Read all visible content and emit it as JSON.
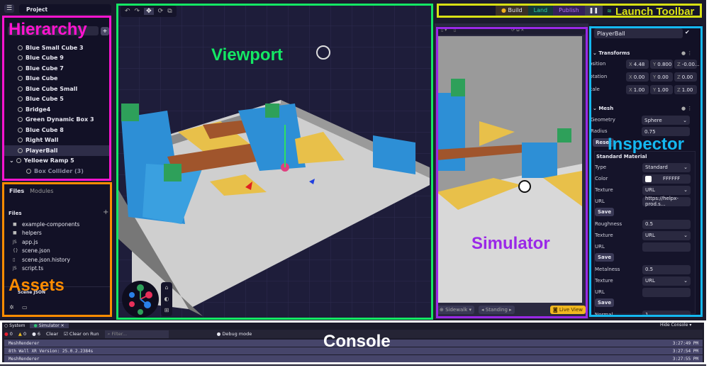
{
  "annotations": {
    "hierarchy": "Hierarchy",
    "viewport": "Viewport",
    "launch_toolbar": "Launch Toolbar",
    "inspector": "Inspector",
    "simulator": "Simulator",
    "assets": "Assets",
    "console": "Console"
  },
  "colors": {
    "hierarchy": "#ff14d0",
    "viewport": "#14e864",
    "launch_toolbar": "#d8e014",
    "inspector": "#14b8f0",
    "simulator": "#9a28e8",
    "assets": "#ff8c00",
    "console": "#ffffff"
  },
  "header": {
    "project_tab": "Project"
  },
  "hierarchy": {
    "items": [
      {
        "label": "Blue Small Cube 3"
      },
      {
        "label": "Blue Cube 9"
      },
      {
        "label": "Blue Cube 7"
      },
      {
        "label": "Blue Cube"
      },
      {
        "label": "Blue Cube Small"
      },
      {
        "label": "Blue Cube 5"
      },
      {
        "label": "Bridge4"
      },
      {
        "label": "Green Dynamic Box 3"
      },
      {
        "label": "Blue Cube 8"
      },
      {
        "label": "Right Wall"
      },
      {
        "label": "PlayerBall",
        "selected": true
      },
      {
        "label": "Yelloew Ramp 5",
        "expanded": true
      },
      {
        "label": "Box Collider (3)",
        "child": true
      }
    ]
  },
  "assets": {
    "tabs": [
      "Files",
      "Modules"
    ],
    "section": "Files",
    "files": [
      {
        "icon": "folder-icon",
        "glyph": "■",
        "name": "example-components"
      },
      {
        "icon": "folder-icon",
        "glyph": "■",
        "name": "helpers"
      },
      {
        "icon": "js-icon",
        "glyph": "JS",
        "name": "app.js"
      },
      {
        "icon": "json-icon",
        "glyph": "{}",
        "name": "scene.json"
      },
      {
        "icon": "file-icon",
        "glyph": "▯",
        "name": "scene.json.history"
      },
      {
        "icon": "js-icon",
        "glyph": "JS",
        "name": "script.ts"
      }
    ],
    "scene_json": "Scene JSON"
  },
  "launch": {
    "build": "Build",
    "land": "Land",
    "publish": "Publish"
  },
  "simulator": {
    "location": "Sidewalk",
    "pose": "Standing",
    "live_view": "Live View"
  },
  "inspector": {
    "name": "PlayerBall",
    "transforms": "Transforms",
    "position": {
      "label": "Position",
      "x": "4.48",
      "y": "0.800",
      "z": "-0.00..."
    },
    "rotation": {
      "label": "Rotation",
      "x": "0.00",
      "y": "0.00",
      "z": "0.00"
    },
    "scale": {
      "label": "Scale",
      "x": "1.00",
      "y": "1.00",
      "z": "1.00"
    },
    "mesh": "Mesh",
    "geometry_label": "Geometry",
    "geometry": "Sphere",
    "radius_label": "Radius",
    "radius": "0.75",
    "reset": "Reset",
    "material": "Standard Material",
    "type_label": "Type",
    "type": "Standard",
    "color_label": "Color",
    "color": "FFFFFF",
    "texture_label": "Texture",
    "url_label": "URL",
    "texture": "URL",
    "url1": "https://helpx-prod.s...",
    "save": "Save",
    "roughness_label": "Roughness",
    "roughness": "0.5",
    "metalness_label": "Metalness",
    "metalness": "0.5",
    "normal_label": "Normal",
    "normal": "1"
  },
  "console": {
    "tabs": [
      "System",
      "Simulator"
    ],
    "errors": "0",
    "warnings": "0",
    "info": "6",
    "clear": "Clear",
    "clear_on_run": "Clear on Run",
    "filter_placeholder": "Filter...",
    "debug": "Debug mode",
    "hide": "Hide Console",
    "logs": [
      {
        "text": "MeshRenderer",
        "time": "3:27:49 PM"
      },
      {
        "text": "8th Wall XR Version: 25.0.2.2384s",
        "time": "3:27:54 PM"
      },
      {
        "text": "MeshRenderer",
        "time": "3:27:55 PM"
      }
    ]
  }
}
